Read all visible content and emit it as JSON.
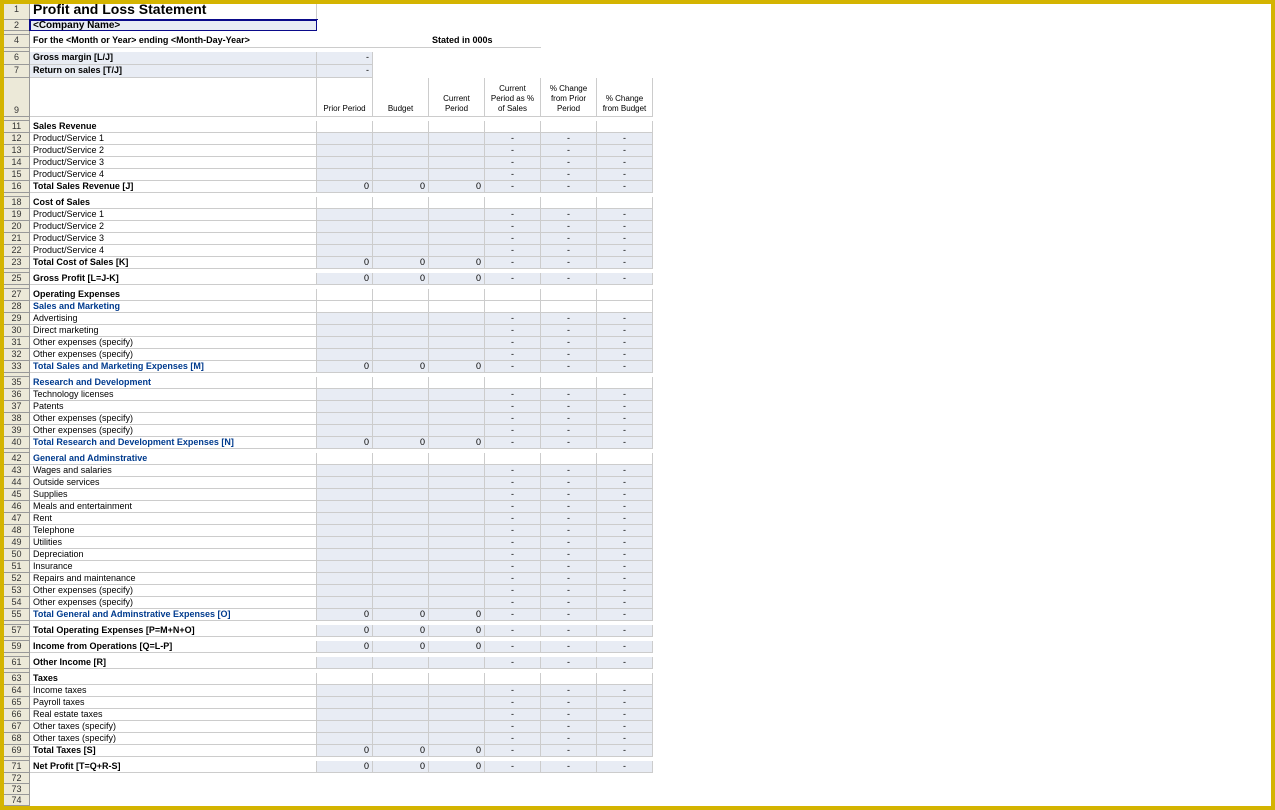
{
  "title": "Profit and Loss Statement",
  "company": "<Company Name>",
  "period_line": "For the <Month or Year> ending <Month-Day-Year>",
  "stated": "Stated in 000s",
  "metrics": {
    "gross_margin": {
      "label": "Gross margin  [L/J]",
      "value": "-"
    },
    "return_on_sales": {
      "label": "Return on sales  [T/J]",
      "value": "-"
    }
  },
  "headers": {
    "c1": "Prior Period",
    "c2": "Budget",
    "c3": "Current Period",
    "c4": "Current Period as % of Sales",
    "c5": "% Change from Prior Period",
    "c6": "% Change from Budget"
  },
  "rows": [
    {
      "n": 11,
      "label": "Sales Revenue",
      "cls": "bold",
      "shade": false,
      "v": [
        "",
        "",
        "",
        "",
        "",
        ""
      ]
    },
    {
      "n": 12,
      "label": "Product/Service 1",
      "cls": "",
      "shade": true,
      "v": [
        "",
        "",
        "",
        "-",
        "-",
        "-"
      ]
    },
    {
      "n": 13,
      "label": "Product/Service 2",
      "cls": "",
      "shade": true,
      "v": [
        "",
        "",
        "",
        "-",
        "-",
        "-"
      ]
    },
    {
      "n": 14,
      "label": "Product/Service 3",
      "cls": "",
      "shade": true,
      "v": [
        "",
        "",
        "",
        "-",
        "-",
        "-"
      ]
    },
    {
      "n": 15,
      "label": "Product/Service 4",
      "cls": "",
      "shade": true,
      "v": [
        "",
        "",
        "",
        "-",
        "-",
        "-"
      ]
    },
    {
      "n": 16,
      "label": "Total Sales Revenue  [J]",
      "cls": "bold",
      "shade": true,
      "v": [
        "0",
        "0",
        "0",
        "-",
        "-",
        "-"
      ]
    },
    {
      "n": "",
      "gap": true
    },
    {
      "n": 18,
      "label": "Cost of Sales",
      "cls": "bold",
      "shade": false,
      "v": [
        "",
        "",
        "",
        "",
        "",
        ""
      ]
    },
    {
      "n": 19,
      "label": "Product/Service 1",
      "cls": "",
      "shade": true,
      "v": [
        "",
        "",
        "",
        "-",
        "-",
        "-"
      ]
    },
    {
      "n": 20,
      "label": "Product/Service 2",
      "cls": "",
      "shade": true,
      "v": [
        "",
        "",
        "",
        "-",
        "-",
        "-"
      ]
    },
    {
      "n": 21,
      "label": "Product/Service 3",
      "cls": "",
      "shade": true,
      "v": [
        "",
        "",
        "",
        "-",
        "-",
        "-"
      ]
    },
    {
      "n": 22,
      "label": "Product/Service 4",
      "cls": "",
      "shade": true,
      "v": [
        "",
        "",
        "",
        "-",
        "-",
        "-"
      ]
    },
    {
      "n": 23,
      "label": "Total Cost of Sales  [K]",
      "cls": "bold",
      "shade": true,
      "v": [
        "0",
        "0",
        "0",
        "-",
        "-",
        "-"
      ]
    },
    {
      "n": "",
      "gap": true
    },
    {
      "n": 25,
      "label": "Gross Profit  [L=J-K]",
      "cls": "bold",
      "shade": true,
      "v": [
        "0",
        "0",
        "0",
        "-",
        "-",
        "-"
      ]
    },
    {
      "n": "",
      "gap": true
    },
    {
      "n": 27,
      "label": "Operating Expenses",
      "cls": "bold",
      "shade": false,
      "v": [
        "",
        "",
        "",
        "",
        "",
        ""
      ]
    },
    {
      "n": 28,
      "label": "Sales and Marketing",
      "cls": "blue",
      "shade": false,
      "v": [
        "",
        "",
        "",
        "",
        "",
        ""
      ]
    },
    {
      "n": 29,
      "label": "Advertising",
      "cls": "",
      "shade": true,
      "v": [
        "",
        "",
        "",
        "-",
        "-",
        "-"
      ]
    },
    {
      "n": 30,
      "label": "Direct marketing",
      "cls": "",
      "shade": true,
      "v": [
        "",
        "",
        "",
        "-",
        "-",
        "-"
      ]
    },
    {
      "n": 31,
      "label": "Other expenses (specify)",
      "cls": "",
      "shade": true,
      "v": [
        "",
        "",
        "",
        "-",
        "-",
        "-"
      ]
    },
    {
      "n": 32,
      "label": "Other expenses (specify)",
      "cls": "",
      "shade": true,
      "v": [
        "",
        "",
        "",
        "-",
        "-",
        "-"
      ]
    },
    {
      "n": 33,
      "label": "Total Sales and Marketing Expenses  [M]",
      "cls": "blue",
      "shade": true,
      "v": [
        "0",
        "0",
        "0",
        "-",
        "-",
        "-"
      ]
    },
    {
      "n": "",
      "gap": true
    },
    {
      "n": 35,
      "label": "Research and Development",
      "cls": "blue",
      "shade": false,
      "v": [
        "",
        "",
        "",
        "",
        "",
        ""
      ]
    },
    {
      "n": 36,
      "label": "Technology licenses",
      "cls": "",
      "shade": true,
      "v": [
        "",
        "",
        "",
        "-",
        "-",
        "-"
      ]
    },
    {
      "n": 37,
      "label": "Patents",
      "cls": "",
      "shade": true,
      "v": [
        "",
        "",
        "",
        "-",
        "-",
        "-"
      ]
    },
    {
      "n": 38,
      "label": "Other expenses (specify)",
      "cls": "",
      "shade": true,
      "v": [
        "",
        "",
        "",
        "-",
        "-",
        "-"
      ]
    },
    {
      "n": 39,
      "label": "Other expenses (specify)",
      "cls": "",
      "shade": true,
      "v": [
        "",
        "",
        "",
        "-",
        "-",
        "-"
      ]
    },
    {
      "n": 40,
      "label": "Total Research and Development Expenses  [N]",
      "cls": "blue",
      "shade": true,
      "v": [
        "0",
        "0",
        "0",
        "-",
        "-",
        "-"
      ]
    },
    {
      "n": "",
      "gap": true
    },
    {
      "n": 42,
      "label": "General and Adminstrative",
      "cls": "blue",
      "shade": false,
      "v": [
        "",
        "",
        "",
        "",
        "",
        ""
      ]
    },
    {
      "n": 43,
      "label": "Wages and salaries",
      "cls": "",
      "shade": true,
      "v": [
        "",
        "",
        "",
        "-",
        "-",
        "-"
      ]
    },
    {
      "n": 44,
      "label": "Outside services",
      "cls": "",
      "shade": true,
      "v": [
        "",
        "",
        "",
        "-",
        "-",
        "-"
      ]
    },
    {
      "n": 45,
      "label": "Supplies",
      "cls": "",
      "shade": true,
      "v": [
        "",
        "",
        "",
        "-",
        "-",
        "-"
      ]
    },
    {
      "n": 46,
      "label": "Meals and entertainment",
      "cls": "",
      "shade": true,
      "v": [
        "",
        "",
        "",
        "-",
        "-",
        "-"
      ]
    },
    {
      "n": 47,
      "label": "Rent",
      "cls": "",
      "shade": true,
      "v": [
        "",
        "",
        "",
        "-",
        "-",
        "-"
      ]
    },
    {
      "n": 48,
      "label": "Telephone",
      "cls": "",
      "shade": true,
      "v": [
        "",
        "",
        "",
        "-",
        "-",
        "-"
      ]
    },
    {
      "n": 49,
      "label": "Utilities",
      "cls": "",
      "shade": true,
      "v": [
        "",
        "",
        "",
        "-",
        "-",
        "-"
      ]
    },
    {
      "n": 50,
      "label": "Depreciation",
      "cls": "",
      "shade": true,
      "v": [
        "",
        "",
        "",
        "-",
        "-",
        "-"
      ]
    },
    {
      "n": 51,
      "label": "Insurance",
      "cls": "",
      "shade": true,
      "v": [
        "",
        "",
        "",
        "-",
        "-",
        "-"
      ]
    },
    {
      "n": 52,
      "label": "Repairs and maintenance",
      "cls": "",
      "shade": true,
      "v": [
        "",
        "",
        "",
        "-",
        "-",
        "-"
      ]
    },
    {
      "n": 53,
      "label": "Other expenses (specify)",
      "cls": "",
      "shade": true,
      "v": [
        "",
        "",
        "",
        "-",
        "-",
        "-"
      ]
    },
    {
      "n": 54,
      "label": "Other expenses (specify)",
      "cls": "",
      "shade": true,
      "v": [
        "",
        "",
        "",
        "-",
        "-",
        "-"
      ]
    },
    {
      "n": 55,
      "label": "Total General and Adminstrative Expenses  [O]",
      "cls": "blue",
      "shade": true,
      "v": [
        "0",
        "0",
        "0",
        "-",
        "-",
        "-"
      ]
    },
    {
      "n": "",
      "gap": true
    },
    {
      "n": 57,
      "label": "Total Operating Expenses  [P=M+N+O]",
      "cls": "bold",
      "shade": true,
      "v": [
        "0",
        "0",
        "0",
        "-",
        "-",
        "-"
      ]
    },
    {
      "n": "",
      "gap": true
    },
    {
      "n": 59,
      "label": "Income from Operations  [Q=L-P]",
      "cls": "bold",
      "shade": true,
      "v": [
        "0",
        "0",
        "0",
        "-",
        "-",
        "-"
      ]
    },
    {
      "n": "",
      "gap": true
    },
    {
      "n": 61,
      "label": "Other Income  [R]",
      "cls": "bold",
      "shade": true,
      "v": [
        "",
        "",
        "",
        "-",
        "-",
        "-"
      ]
    },
    {
      "n": "",
      "gap": true
    },
    {
      "n": 63,
      "label": "Taxes",
      "cls": "bold",
      "shade": false,
      "v": [
        "",
        "",
        "",
        "",
        "",
        ""
      ]
    },
    {
      "n": 64,
      "label": "Income taxes",
      "cls": "",
      "shade": true,
      "v": [
        "",
        "",
        "",
        "-",
        "-",
        "-"
      ]
    },
    {
      "n": 65,
      "label": "Payroll taxes",
      "cls": "",
      "shade": true,
      "v": [
        "",
        "",
        "",
        "-",
        "-",
        "-"
      ]
    },
    {
      "n": 66,
      "label": "Real estate taxes",
      "cls": "",
      "shade": true,
      "v": [
        "",
        "",
        "",
        "-",
        "-",
        "-"
      ]
    },
    {
      "n": 67,
      "label": "Other taxes (specify)",
      "cls": "",
      "shade": true,
      "v": [
        "",
        "",
        "",
        "-",
        "-",
        "-"
      ]
    },
    {
      "n": 68,
      "label": "Other taxes (specify)",
      "cls": "",
      "shade": true,
      "v": [
        "",
        "",
        "",
        "-",
        "-",
        "-"
      ]
    },
    {
      "n": 69,
      "label": "Total Taxes  [S]",
      "cls": "bold",
      "shade": true,
      "v": [
        "0",
        "0",
        "0",
        "-",
        "-",
        "-"
      ]
    },
    {
      "n": "",
      "gap": true
    },
    {
      "n": 71,
      "label": "Net Profit  [T=Q+R-S]",
      "cls": "bold",
      "shade": true,
      "v": [
        "0",
        "0",
        "0",
        "-",
        "-",
        "-"
      ]
    }
  ]
}
